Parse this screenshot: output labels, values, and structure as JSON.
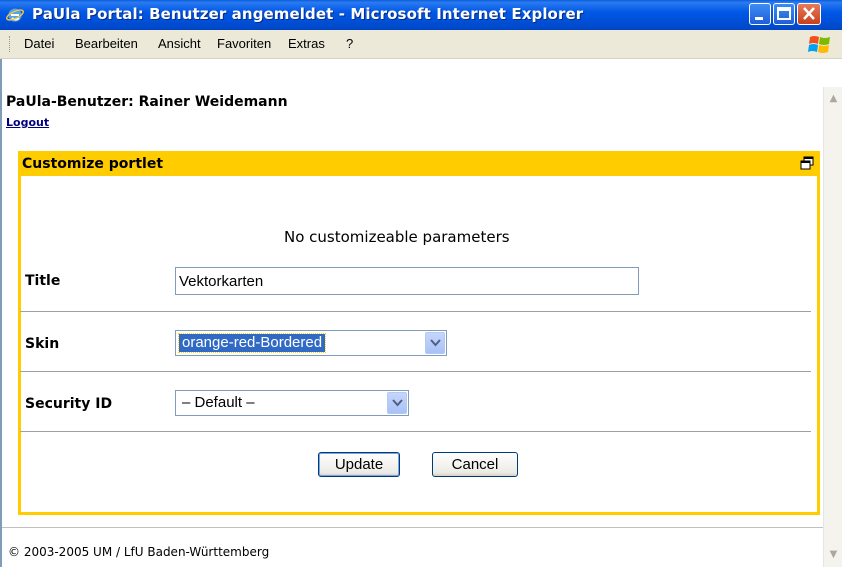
{
  "window": {
    "title": "PaUla Portal: Benutzer angemeldet - Microsoft Internet Explorer"
  },
  "menu": {
    "items": [
      "Datei",
      "Bearbeiten",
      "Ansicht",
      "Favoriten",
      "Extras",
      "?"
    ]
  },
  "page": {
    "user_label": "PaUla-Benutzer: Rainer Weidemann",
    "logout_link": "Logout"
  },
  "portlet": {
    "header_title": "Customize portlet",
    "message": "No customizeable parameters",
    "fields": {
      "title_label": "Title",
      "title_value": "Vektorkarten",
      "skin_label": "Skin",
      "skin_value": "orange-red-Bordered",
      "security_label": "Security ID",
      "security_value": "– Default –"
    },
    "buttons": {
      "update": "Update",
      "cancel": "Cancel"
    },
    "accent_color": "#ffcc00"
  },
  "footer": {
    "copyright": "© 2003-2005 UM / LfU Baden-Württemberg"
  }
}
